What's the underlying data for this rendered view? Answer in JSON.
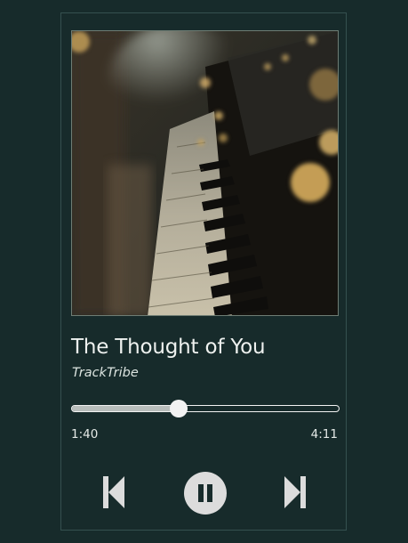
{
  "track": {
    "title": "The Thought of You",
    "artist": "TrackTribe",
    "artwork_icon": "piano-keys-image"
  },
  "progress": {
    "current_time": "1:40",
    "total_time": "4:11",
    "fraction": 0.4
  },
  "controls": {
    "previous_icon": "skip-previous-icon",
    "play_pause_icon": "pause-icon",
    "next_icon": "skip-next-icon"
  },
  "colors": {
    "background": "#172b2b",
    "text": "#eef1ef",
    "accent": "#f2f2f2"
  }
}
